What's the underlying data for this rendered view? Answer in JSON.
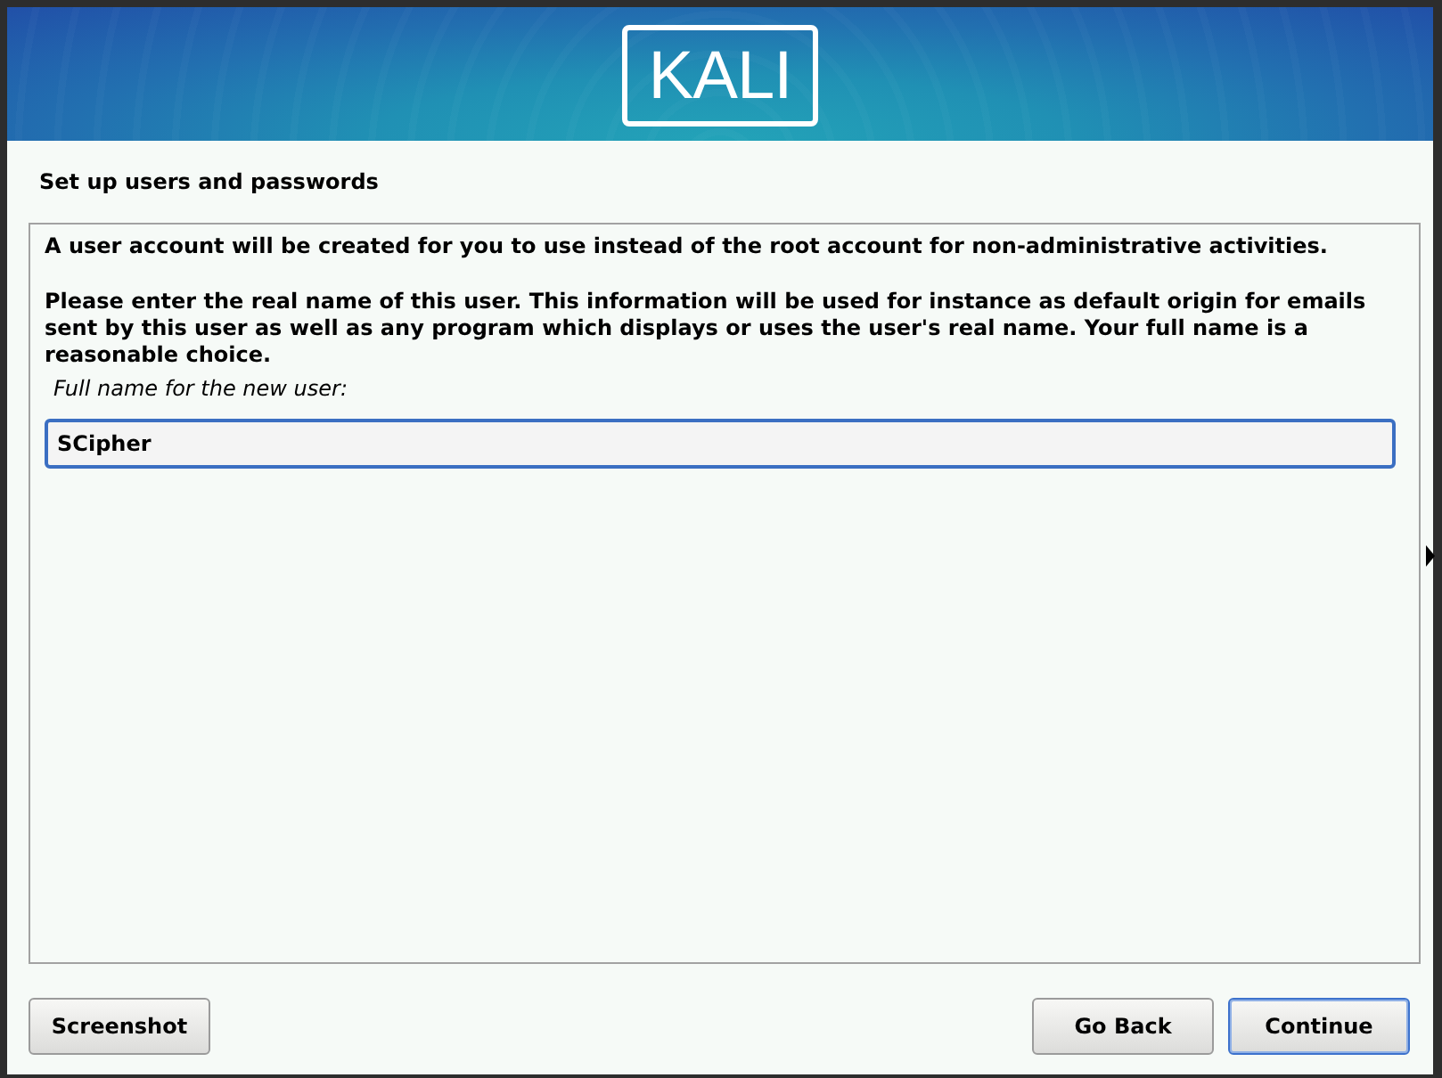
{
  "banner": {
    "logo": "KALI"
  },
  "title": "Set up users and passwords",
  "panel": {
    "paragraphs": [
      "A user account will be created for you to use instead of the root account for non-administrative activities.",
      "Please enter the real name of this user. This information will be used for instance as default origin for emails sent by this user as well as any program which displays or uses the user's real name. Your full name is a reasonable choice."
    ],
    "field": {
      "label": "Full name for the new user:",
      "value": "SCipher",
      "focused": true
    }
  },
  "footer": {
    "left_buttons": [
      {
        "label": "Screenshot",
        "focused": false
      }
    ],
    "right_buttons": [
      {
        "label": "Go Back",
        "focused": false
      },
      {
        "label": "Continue",
        "focused": true
      }
    ]
  }
}
